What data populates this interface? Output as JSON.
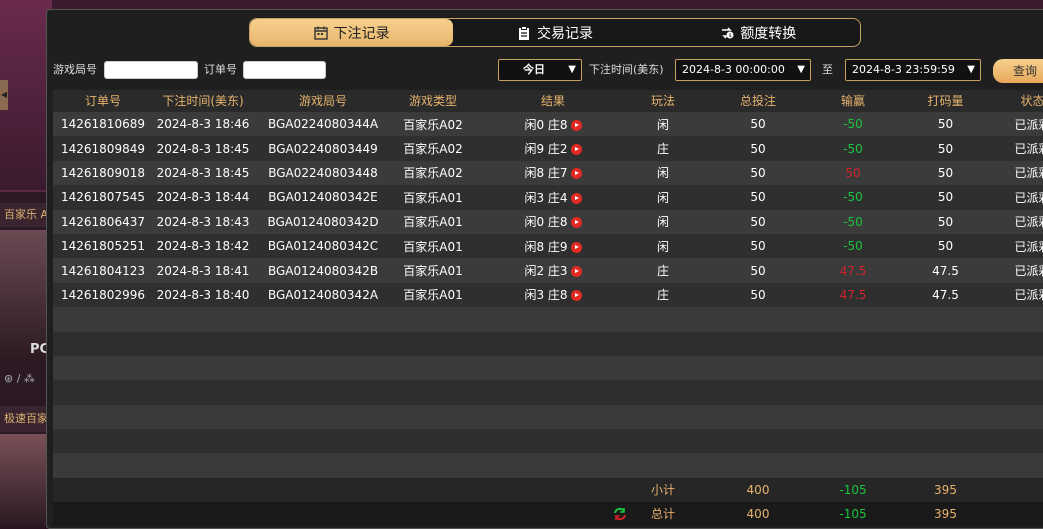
{
  "background": {
    "label_top": "百家乐 A",
    "label_bottom": "极速百家",
    "avatar_text": "PC",
    "icons_text": "⊛ / ⁂"
  },
  "tabs": [
    {
      "label": "下注记录",
      "icon": "calendar-icon",
      "active": true
    },
    {
      "label": "交易记录",
      "icon": "clipboard-icon",
      "active": false
    },
    {
      "label": "额度转换",
      "icon": "exchange-icon",
      "active": false
    }
  ],
  "filters": {
    "game_round_label": "游戏局号",
    "order_no_label": "订单号",
    "period": "今日",
    "time_label": "下注时间(美东)",
    "start_time": "2024-8-3 00:00:00",
    "to_label": "至",
    "end_time": "2024-8-3 23:59:59",
    "query_label": "查询"
  },
  "table": {
    "headers": [
      "订单号",
      "下注时间(美东)",
      "游戏局号",
      "游戏类型",
      "结果",
      "玩法",
      "总投注",
      "输赢",
      "打码量",
      "状态"
    ],
    "rows": [
      {
        "order": "14261810689",
        "time": "2024-8-3 18:46",
        "round": "BGA0224080344A",
        "type": "百家乐A02",
        "result": "闲0 庄8",
        "play": "闲",
        "bet": "50",
        "winloss": "-50",
        "wl_color": "green",
        "valid": "50",
        "status": "已派彩"
      },
      {
        "order": "14261809849",
        "time": "2024-8-3 18:45",
        "round": "BGA02240803449",
        "type": "百家乐A02",
        "result": "闲9 庄2",
        "play": "庄",
        "bet": "50",
        "winloss": "-50",
        "wl_color": "green",
        "valid": "50",
        "status": "已派彩"
      },
      {
        "order": "14261809018",
        "time": "2024-8-3 18:45",
        "round": "BGA02240803448",
        "type": "百家乐A02",
        "result": "闲8 庄7",
        "play": "闲",
        "bet": "50",
        "winloss": "50",
        "wl_color": "red",
        "valid": "50",
        "status": "已派彩"
      },
      {
        "order": "14261807545",
        "time": "2024-8-3 18:44",
        "round": "BGA0124080342E",
        "type": "百家乐A01",
        "result": "闲3 庄4",
        "play": "闲",
        "bet": "50",
        "winloss": "-50",
        "wl_color": "green",
        "valid": "50",
        "status": "已派彩"
      },
      {
        "order": "14261806437",
        "time": "2024-8-3 18:43",
        "round": "BGA0124080342D",
        "type": "百家乐A01",
        "result": "闲0 庄8",
        "play": "闲",
        "bet": "50",
        "winloss": "-50",
        "wl_color": "green",
        "valid": "50",
        "status": "已派彩"
      },
      {
        "order": "14261805251",
        "time": "2024-8-3 18:42",
        "round": "BGA0124080342C",
        "type": "百家乐A01",
        "result": "闲8 庄9",
        "play": "闲",
        "bet": "50",
        "winloss": "-50",
        "wl_color": "green",
        "valid": "50",
        "status": "已派彩"
      },
      {
        "order": "14261804123",
        "time": "2024-8-3 18:41",
        "round": "BGA0124080342B",
        "type": "百家乐A01",
        "result": "闲2 庄3",
        "play": "庄",
        "bet": "50",
        "winloss": "47.5",
        "wl_color": "red",
        "valid": "47.5",
        "status": "已派彩"
      },
      {
        "order": "14261802996",
        "time": "2024-8-3 18:40",
        "round": "BGA0124080342A",
        "type": "百家乐A01",
        "result": "闲3 庄8",
        "play": "庄",
        "bet": "50",
        "winloss": "47.5",
        "wl_color": "red",
        "valid": "47.5",
        "status": "已派彩"
      }
    ],
    "subtotal": {
      "label": "小计",
      "bet": "400",
      "winloss": "-105",
      "valid": "395"
    },
    "total": {
      "label": "总计",
      "bet": "400",
      "winloss": "-105",
      "valid": "395"
    }
  },
  "colors": {
    "accent": "#e8b66b",
    "win": "#d0232a",
    "lose": "#19c43f"
  }
}
